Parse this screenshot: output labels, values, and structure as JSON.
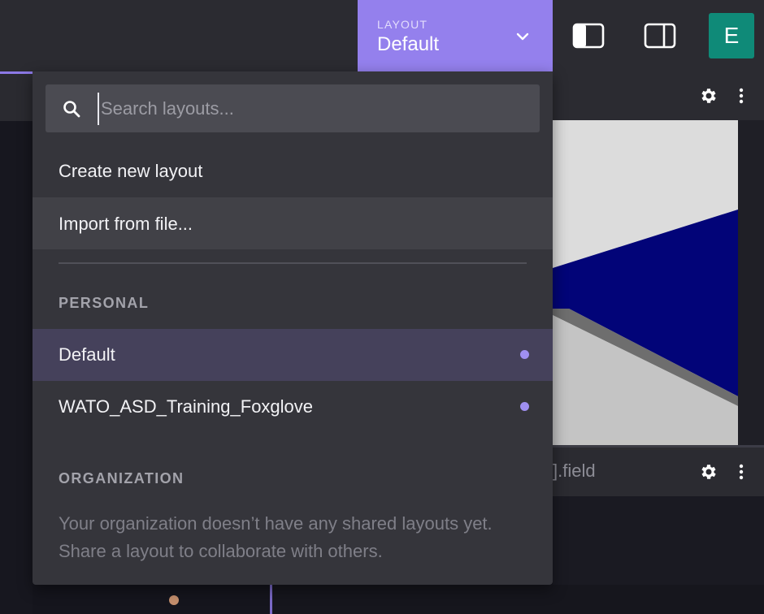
{
  "topbar": {
    "layout_button": {
      "caption": "LAYOUT",
      "name": "Default",
      "icon": "chevron-down-icon",
      "color": "#9480ed"
    },
    "left_sidebar_toggle_icon": "left-sidebar-toggle-icon",
    "right_sidebar_toggle_icon": "right-sidebar-toggle-icon",
    "avatar": {
      "initial": "E",
      "color": "#0f8a78"
    }
  },
  "panels": {
    "image_panel": {
      "settings_icon": "gear-icon",
      "menu_icon": "more-vertical-icon"
    },
    "field_panel": {
      "title_fragment": "].field",
      "settings_icon": "gear-icon",
      "menu_icon": "more-vertical-icon"
    }
  },
  "layout_menu": {
    "search": {
      "placeholder": "Search layouts...",
      "value": "",
      "icon": "search-icon"
    },
    "actions": [
      {
        "label": "Create new layout"
      },
      {
        "label": "Import from file..."
      }
    ],
    "personal": {
      "heading": "PERSONAL",
      "layouts": [
        {
          "name": "Default",
          "selected": true
        },
        {
          "name": "WATO_ASD_Training_Foxglove",
          "selected": false
        }
      ]
    },
    "organization": {
      "heading": "ORGANIZATION",
      "empty_message": "Your organization doesn’t have any shared layouts yet. Share a layout to collaborate with others."
    }
  },
  "colors": {
    "accent": "#9480ed",
    "menu_background": "#35353b",
    "selected_row": "#45415b",
    "unsaved_dot": "#9f8ff0"
  }
}
